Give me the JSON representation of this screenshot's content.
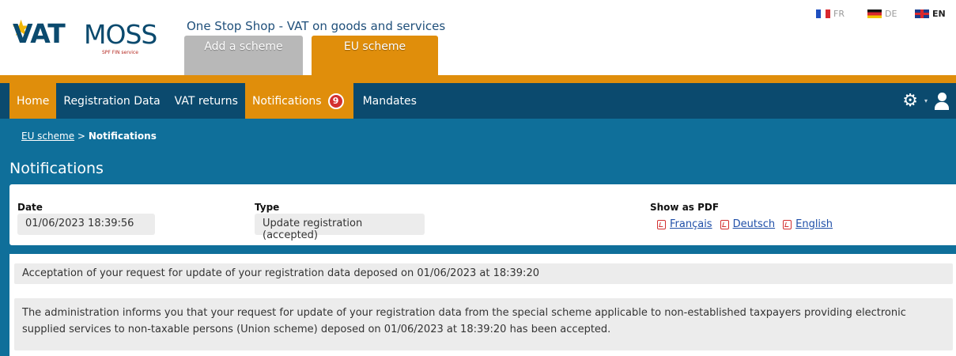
{
  "header": {
    "logo": {
      "vat": "VAT",
      "moss": "MOSS",
      "subtitle": "SPF FIN service",
      "star_icon": "star-icon"
    },
    "app_title": "One Stop Shop - VAT on goods and services",
    "tabs": [
      {
        "label": "Add a scheme",
        "active": false
      },
      {
        "label": "EU scheme",
        "active": true
      }
    ],
    "languages": [
      {
        "code": "FR",
        "flag": "flag-fr-icon",
        "active": false
      },
      {
        "code": "DE",
        "flag": "flag-de-icon",
        "active": false
      },
      {
        "code": "EN",
        "flag": "flag-en-icon",
        "active": true
      }
    ]
  },
  "nav": {
    "items": [
      {
        "label": "Home"
      },
      {
        "label": "Registration Data"
      },
      {
        "label": "VAT returns"
      },
      {
        "label": "Notifications",
        "badge": "9"
      },
      {
        "label": "Mandates"
      }
    ],
    "right_icons": [
      "gear-icon",
      "chevron-down-icon",
      "user-icon"
    ]
  },
  "breadcrumb": {
    "parent": "EU scheme",
    "separator": ">",
    "current": "Notifications"
  },
  "page_title": "Notifications",
  "summary": {
    "date_label": "Date",
    "date_value": "01/06/2023 18:39:56",
    "type_label": "Type",
    "type_value": "Update registration (accepted)",
    "pdf_label": "Show as PDF",
    "pdf_links": [
      "Français",
      "Deutsch",
      "English"
    ]
  },
  "message": {
    "title": "Acceptation of your request for update of your registration data deposed on 01/06/2023 at 18:39:20",
    "body_line1": "The administration informs you that your request for update of your registration data from the special scheme applicable to non-established taxpayers providing electronic",
    "body_line2": "supplied services to non-taxable persons (Union scheme) deposed on 01/06/2023 at 18:39:20 has been accepted."
  },
  "colors": {
    "navy": "#0b4a6e",
    "orange": "#e08e0b",
    "blue": "#0f6f9a",
    "badge_red": "#d32f2f",
    "field_gray": "#ececec"
  }
}
